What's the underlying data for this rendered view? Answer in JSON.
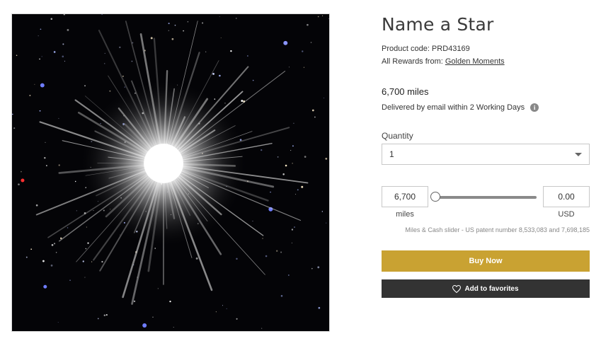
{
  "product": {
    "title": "Name a Star",
    "code_line": "Product code: PRD43169",
    "rewards_prefix": "All Rewards from: ",
    "rewards_link": "Golden Moments",
    "price": "6,700 miles",
    "delivery": "Delivered by email within 2 Working Days",
    "info_icon": "i"
  },
  "quantity": {
    "label": "Quantity",
    "selected": "1"
  },
  "slider": {
    "miles_value": "6,700",
    "miles_unit": "miles",
    "usd_value": "0.00",
    "usd_unit": "USD",
    "position": 0,
    "patent_note": "Miles & Cash slider - US patent number 8,533,083 and 7,698,185"
  },
  "actions": {
    "buy_label": "Buy Now",
    "favorites_label": "Add to favorites"
  },
  "colors": {
    "buy_button": "#c9a232",
    "favorites_button": "#333333"
  }
}
